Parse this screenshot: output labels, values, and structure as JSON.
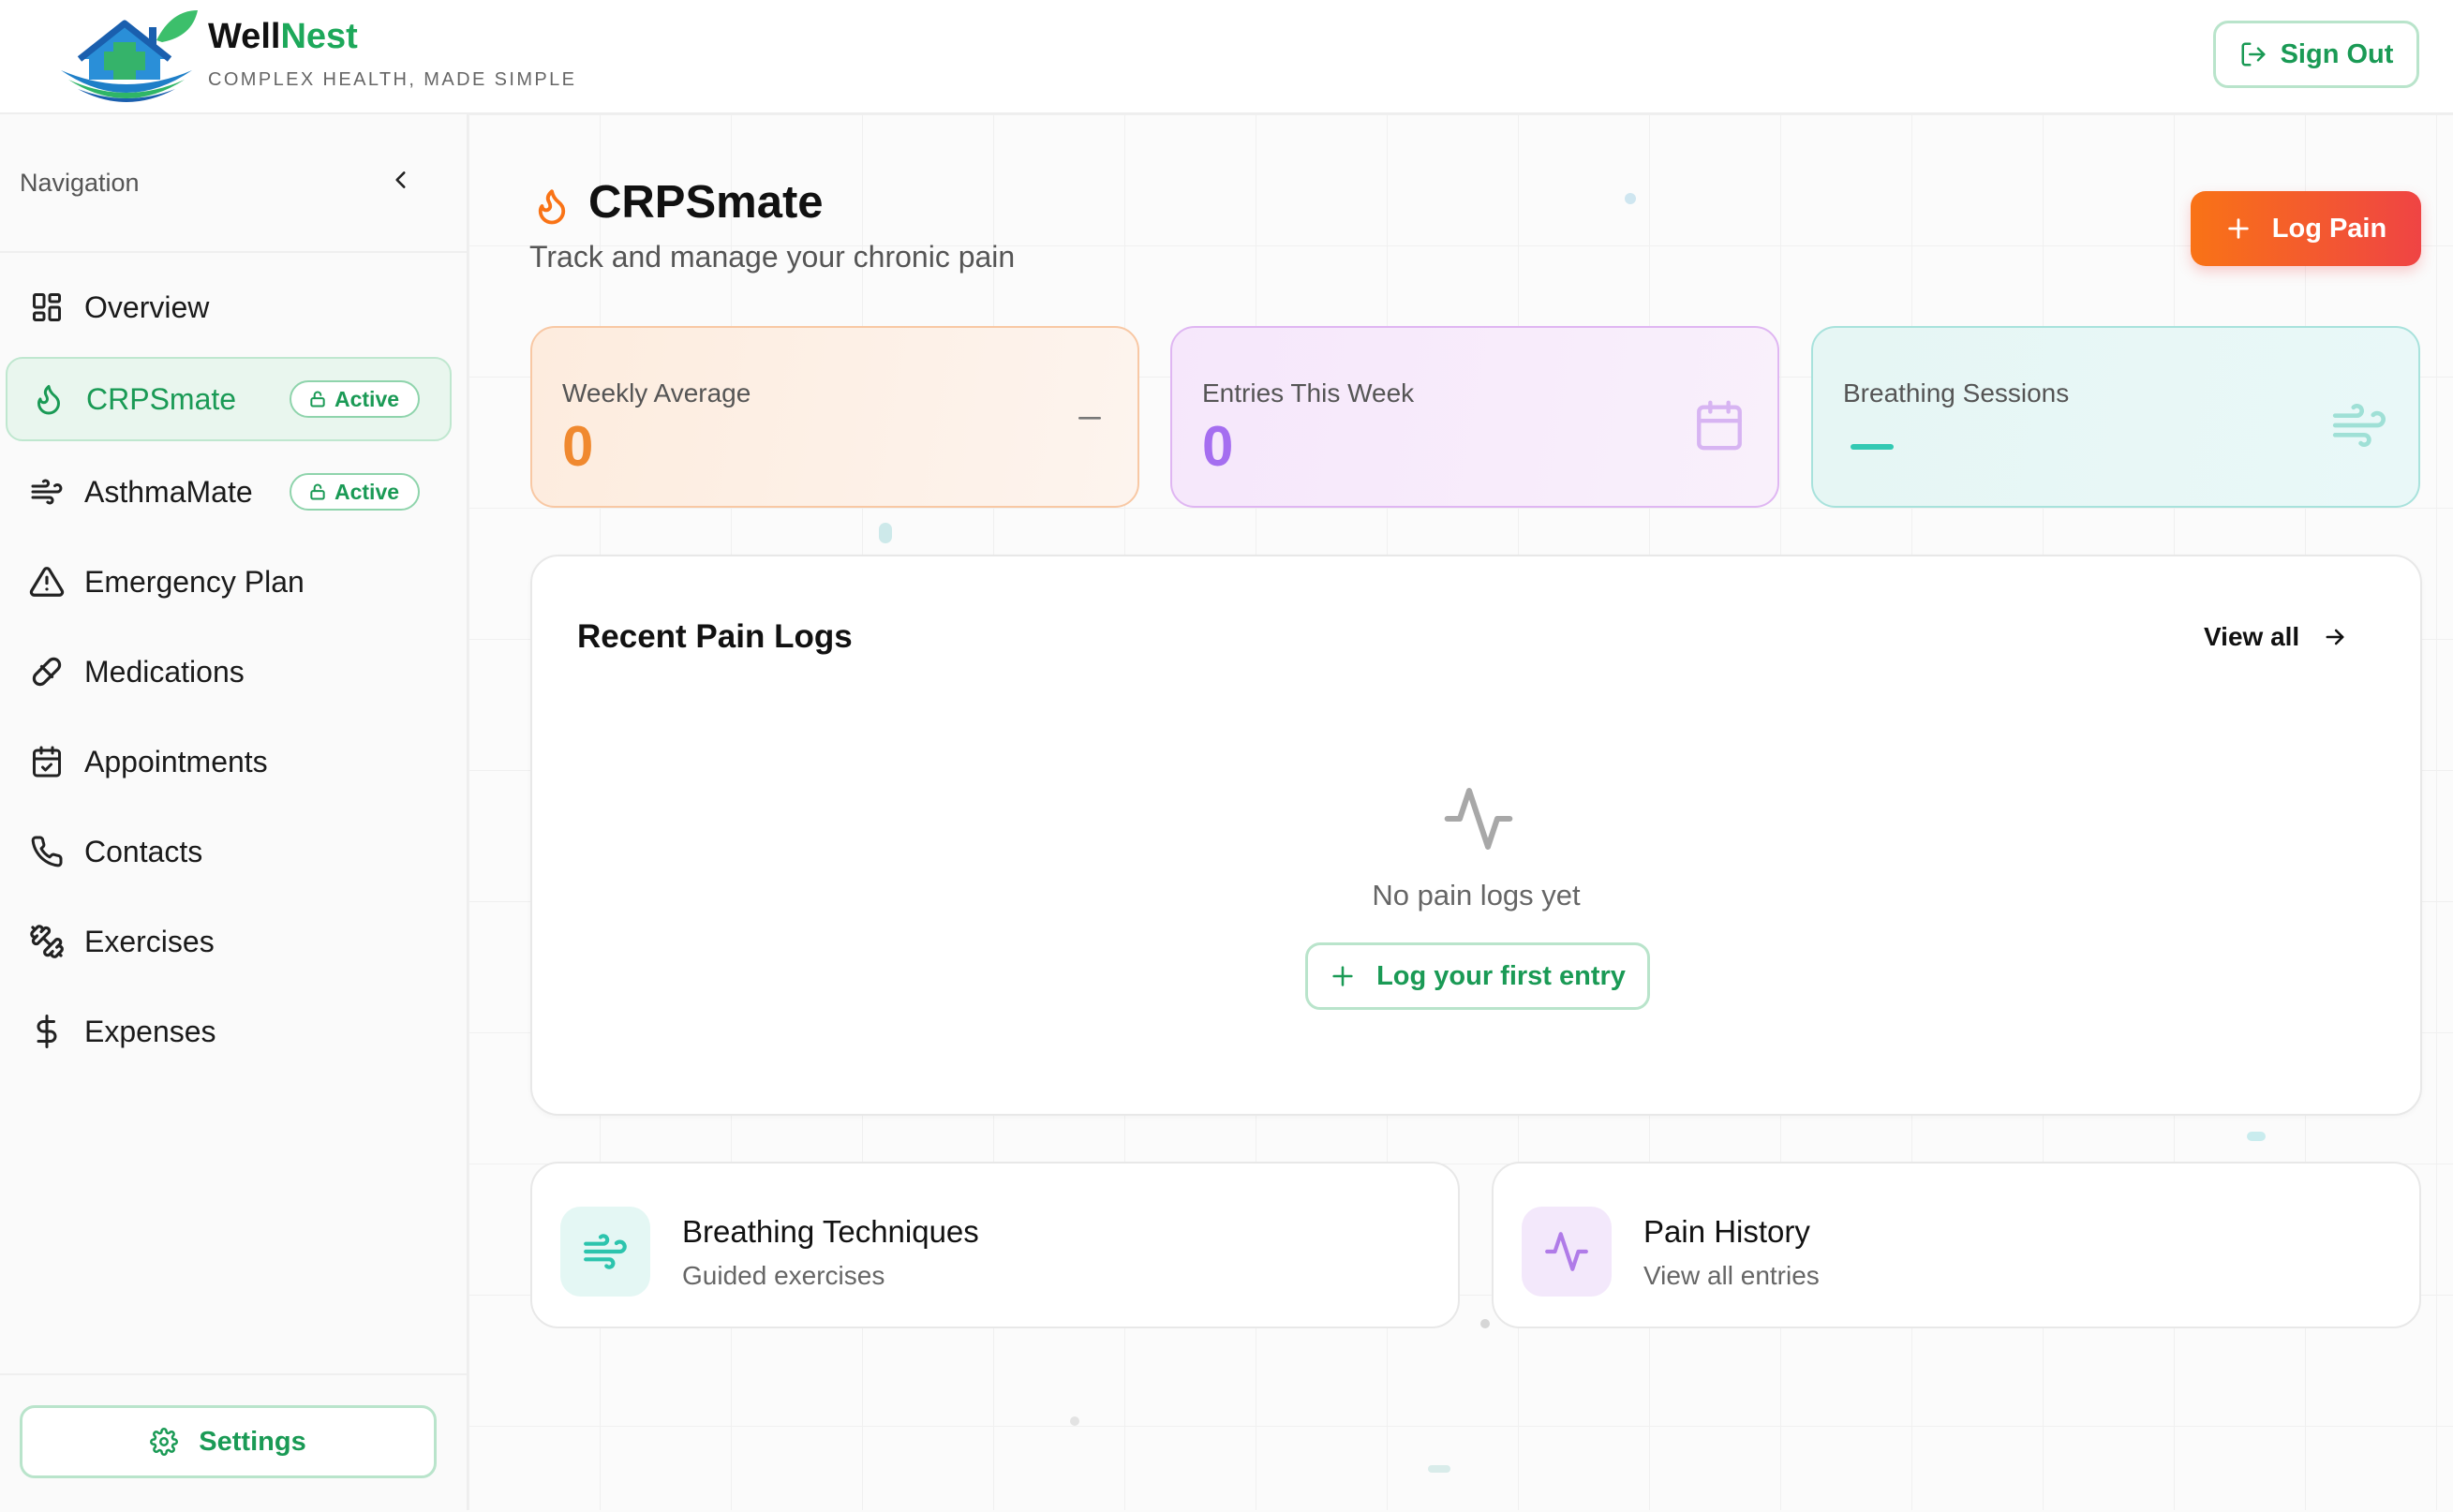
{
  "header": {
    "brand_part1": "Well",
    "brand_part2": "Nest",
    "tagline": "COMPLEX HEALTH, MADE SIMPLE",
    "sign_out_label": "Sign Out"
  },
  "sidebar": {
    "title": "Navigation",
    "items": [
      {
        "label": "Overview",
        "icon": "layout-grid-icon"
      },
      {
        "label": "CRPSmate",
        "icon": "flame-icon",
        "badge": "Active",
        "active": true
      },
      {
        "label": "AsthmaMate",
        "icon": "wind-icon",
        "badge": "Active"
      },
      {
        "label": "Emergency Plan",
        "icon": "alert-triangle-icon"
      },
      {
        "label": "Medications",
        "icon": "pill-icon"
      },
      {
        "label": "Appointments",
        "icon": "calendar-check-icon"
      },
      {
        "label": "Contacts",
        "icon": "phone-icon"
      },
      {
        "label": "Exercises",
        "icon": "dumbbell-icon"
      },
      {
        "label": "Expenses",
        "icon": "dollar-icon"
      }
    ],
    "settings_label": "Settings"
  },
  "main": {
    "title": "CRPSmate",
    "subtitle": "Track and manage your chronic pain",
    "log_pain_label": "Log Pain",
    "stats": [
      {
        "label": "Weekly Average",
        "value": "0",
        "icon": "minus-icon"
      },
      {
        "label": "Entries This Week",
        "value": "0",
        "icon": "calendar-icon"
      },
      {
        "label": "Breathing Sessions",
        "value": "",
        "icon": "wind-icon"
      }
    ],
    "recent": {
      "title": "Recent Pain Logs",
      "view_all_label": "View all",
      "empty_text": "No pain logs yet",
      "first_entry_label": "Log your first entry"
    },
    "quick_links": [
      {
        "title": "Breathing Techniques",
        "subtitle": "Guided exercises",
        "icon": "wind-icon"
      },
      {
        "title": "Pain History",
        "subtitle": "View all entries",
        "icon": "activity-icon"
      }
    ]
  },
  "colors": {
    "brand_green": "#1a9a55",
    "accent_orange": "#f97316",
    "accent_red": "#ef4444",
    "purple": "#a56ef0",
    "teal": "#33c9b3"
  }
}
